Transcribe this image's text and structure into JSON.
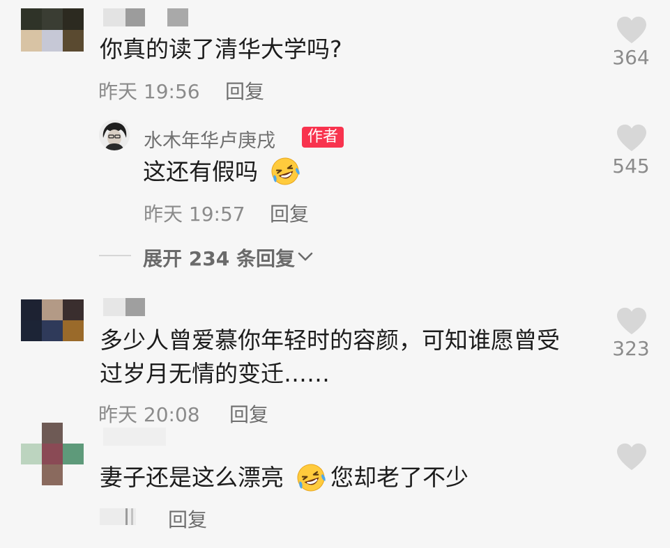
{
  "comments": [
    {
      "text": "你真的读了清华大学吗?",
      "time": "昨天 19:56",
      "reply_label": "回复",
      "likes": "364",
      "replies": [
        {
          "author": "水木年华卢庚戌",
          "badge": "作者",
          "text": "这还有假吗",
          "emoji": "grinning-squinting-tears-emoji",
          "time": "昨天 19:57",
          "reply_label": "回复",
          "likes": "545"
        }
      ],
      "expand_label": "展开 234 条回复"
    },
    {
      "text_line1": "多少人曾爱慕你年轻时的容颜，可知谁愿曾受",
      "text_line2": "过岁月无情的变迁……",
      "time": "昨天 20:08",
      "reply_label": "回复",
      "likes": "323"
    },
    {
      "text_before": "妻子还是这么漂亮",
      "emoji": "grinning-squinting-tears-emoji",
      "text_after": "您却老了不少",
      "reply_label": "回复"
    }
  ],
  "icons": {
    "like": "heart-icon",
    "expand": "chevron-down-icon"
  },
  "colors": {
    "background": "#f6f6f6",
    "author_badge": "#f8334e",
    "heart": "#d7d7d7"
  }
}
